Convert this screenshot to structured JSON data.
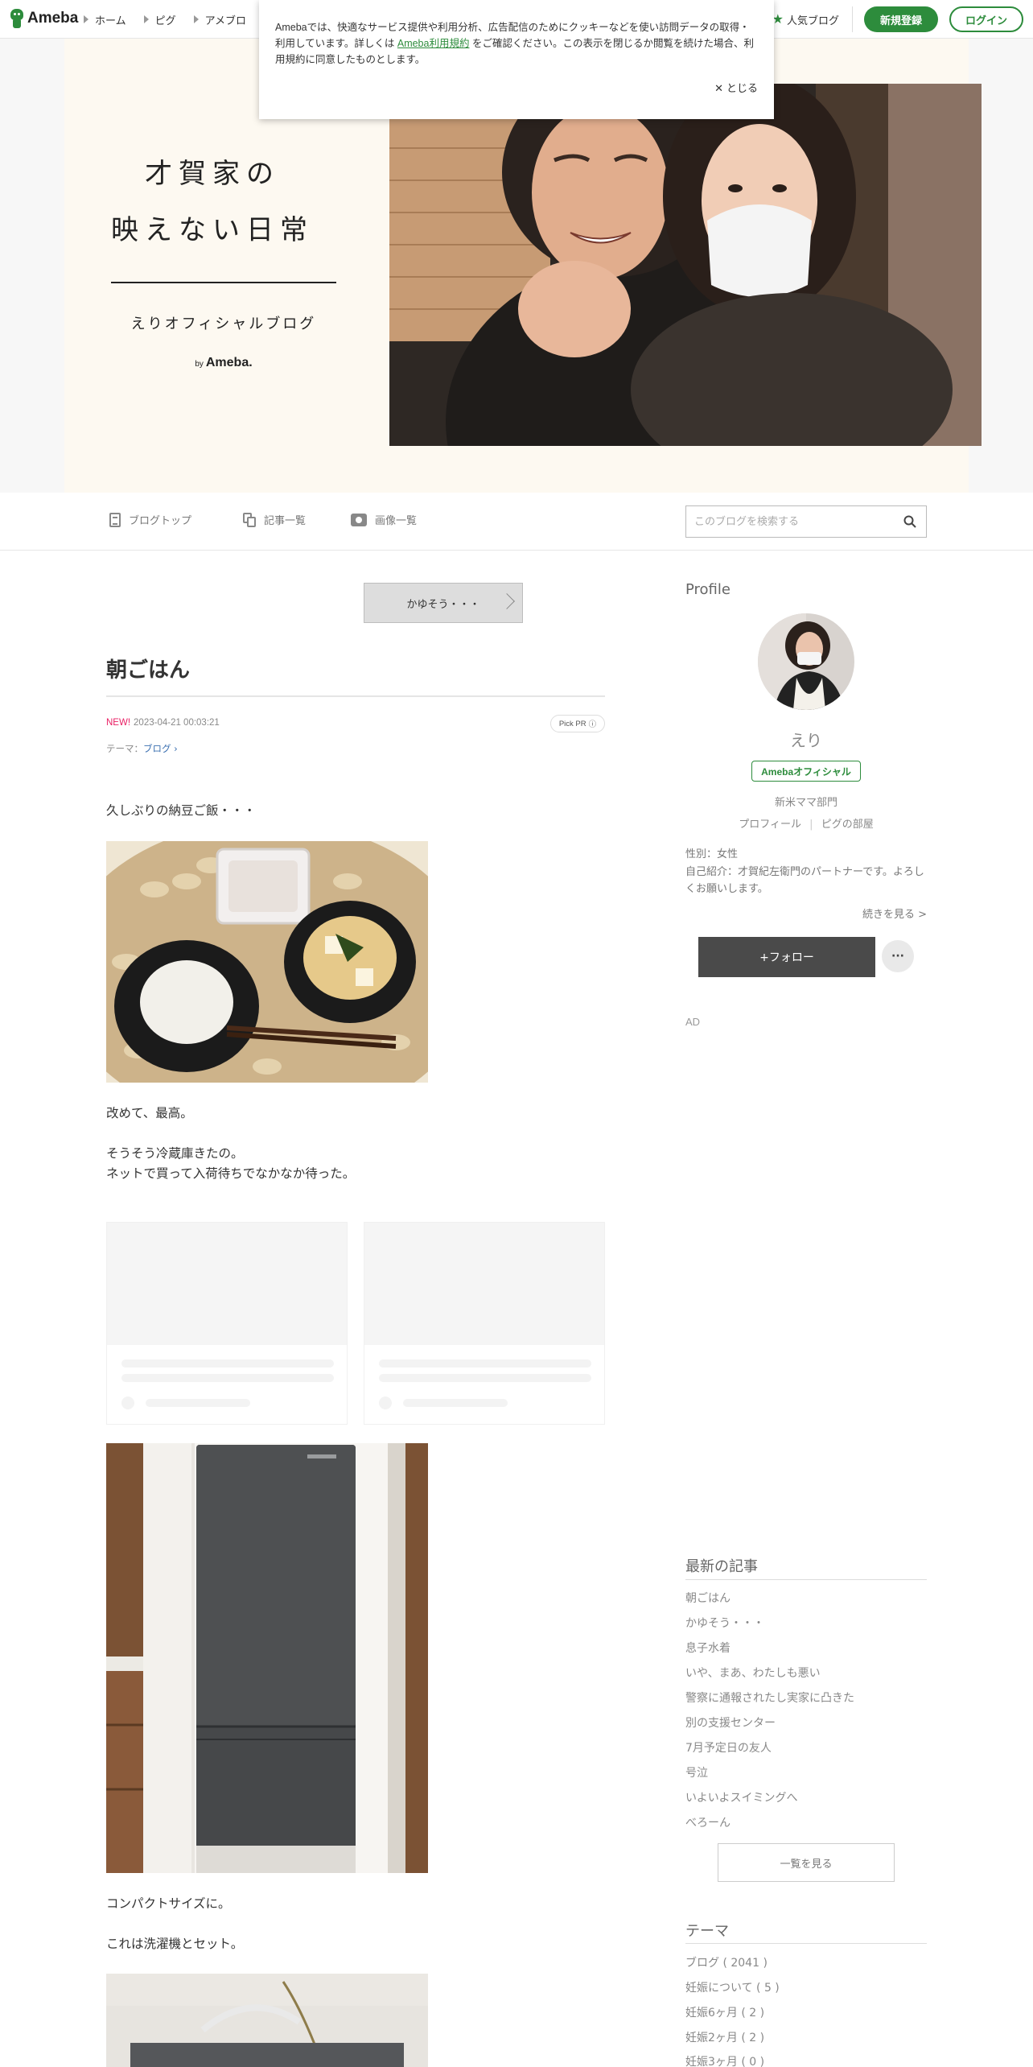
{
  "topnav": {
    "logo": "Ameba",
    "links": [
      "ホーム",
      "ピグ",
      "アメブロ"
    ],
    "popular": "人気ブログ",
    "signup": "新規登録",
    "login": "ログイン"
  },
  "cookie": {
    "text_before": "Amebaでは、快適なサービス提供や利用分析、広告配信のためにクッキーなどを使い訪問データの取得・利用しています。詳しくは ",
    "link": "Ameba利用規約",
    "text_after": " をご確認ください。この表示を閉じるか閲覧を続けた場合、利用規約に同意したものとします。",
    "close": "とじる"
  },
  "banner": {
    "title_line1": "才賀家の",
    "title_line2": "映えない日常",
    "subtitle": "えりオフィシャルブログ",
    "by": "by",
    "ameba": "Ameba."
  },
  "subnav": {
    "blog_top": "ブログトップ",
    "articles": "記事一覧",
    "images": "画像一覧",
    "search_placeholder": "このブログを検索する"
  },
  "article": {
    "prev_post": "かゆそう・・・",
    "title": "朝ごはん",
    "new_label": "NEW!",
    "date": "2023-04-21 00:03:21",
    "pick_pr": "Pick PR",
    "theme_label": "テーマ：",
    "theme_link": "ブログ",
    "p1": "久しぶりの納豆ご飯・・・",
    "p2": "改めて、最高。",
    "p3": "そうそう冷蔵庫きたの。",
    "p4": "ネットで買って入荷待ちでなかなか待った。",
    "p5": "コンパクトサイズに。",
    "p6": "これは洗濯機とセット。"
  },
  "sidebar": {
    "profile_head": "Profile",
    "name": "えり",
    "badge": "Amebaオフィシャル",
    "dept": "新米ママ部門",
    "profile_link": "プロフィール",
    "pig_link": "ピグの部屋",
    "gender": "性別：女性",
    "intro": "自己紹介：才賀紀左衛門のパートナーです。よろしくお願いします。",
    "read_more": "続きを見る >",
    "follow": "+フォロー",
    "more": "···",
    "ad": "AD",
    "recent_head": "最新の記事",
    "recent": [
      "朝ごはん",
      "かゆそう・・・",
      "息子水着",
      "いや、まあ、わたしも悪い",
      "警察に通報されたし実家に凸きた",
      "別の支援センター",
      "7月予定日の友人",
      "号泣",
      "いよいよスイミングへ",
      "べろーん"
    ],
    "view_all": "一覧を見る",
    "theme_head": "テーマ",
    "themes": [
      "ブログ ( 2041 )",
      "妊娠について ( 5 )",
      "妊娠6ヶ月 ( 2 )",
      "妊娠2ヶ月 ( 2 )",
      "妊娠3ヶ月 ( 0 )"
    ]
  }
}
